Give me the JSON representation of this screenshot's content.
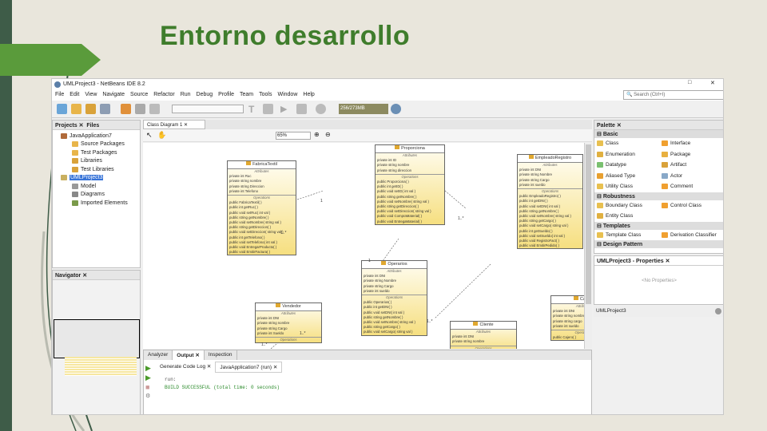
{
  "slide": {
    "title": "Entorno desarrollo"
  },
  "window": {
    "title": "UMLProject3 - NetBeans IDE 8.2",
    "search_placeholder": "Search (Ctrl+I)",
    "memory": "256/273MB"
  },
  "menu": [
    "File",
    "Edit",
    "View",
    "Navigate",
    "Source",
    "Refactor",
    "Run",
    "Debug",
    "Profile",
    "Team",
    "Tools",
    "Window",
    "Help"
  ],
  "projects": {
    "tabs": [
      "Projects",
      "Files"
    ],
    "items": [
      {
        "label": "JavaApplication7",
        "level": 0
      },
      {
        "label": "Source Packages",
        "level": 1
      },
      {
        "label": "Test Packages",
        "level": 1
      },
      {
        "label": "Libraries",
        "level": 1
      },
      {
        "label": "Test Libraries",
        "level": 1
      },
      {
        "label": "UMLProject3",
        "level": 0,
        "selected": true
      },
      {
        "label": "Model",
        "level": 1
      },
      {
        "label": "Diagrams",
        "level": 1
      },
      {
        "label": "Imported Elements",
        "level": 1
      }
    ]
  },
  "navigator": {
    "tab": "Navigator"
  },
  "editor": {
    "tab": "Class Diagram 1",
    "zoom": "65%"
  },
  "classes": [
    {
      "name": "FabricaTextil",
      "attrs": [
        "private int Ruc",
        "private string nombre",
        "private string Direccion",
        "private int Telefono"
      ],
      "ops": [
        "public FabricaTextil( )",
        "public int getRuc( )",
        "public void setRuc( int val )",
        "public string getNombre( )",
        "public void setNombre( string val )",
        "public string getDireccion( )",
        "public void setDireccion( string val )",
        "public int getTelefono( )",
        "public void setTelefono( int val )",
        "public void EntregarProducto( )",
        "public void EmitirFactura( )"
      ]
    },
    {
      "name": "Proporciona",
      "attrs": [
        "private int ID",
        "private string nombre",
        "private string direccion"
      ],
      "ops": [
        "public Proporciona( )",
        "public int getID( )",
        "public void setID( int val )",
        "public string getNombre( )",
        "public void setNombre( string val )",
        "public string getDireccion( )",
        "public void setDireccion( string val )",
        "public void CompraMaterial( )",
        "public void EntregaMaterial( )"
      ]
    },
    {
      "name": "EmpleadoRegistro",
      "attrs": [
        "private int DNI",
        "private string Nombre",
        "private string Cargo",
        "private int sueldo"
      ],
      "ops": [
        "public EmpleadoRegistro( )",
        "public int getDNI( )",
        "public void setDNI( int val )",
        "public string getNombre( )",
        "public void setNombre( string val )",
        "public string getCargo( )",
        "public void setCargo( string val )",
        "public int getSueldo( )",
        "public void setSueldo( int val )",
        "public void RegistroFact( )",
        "public void EmitirPedido( )"
      ]
    },
    {
      "name": "Operarios",
      "attrs": [
        "private int DNI",
        "private string Nombre",
        "private string Cargo",
        "private int sueldo"
      ],
      "ops": [
        "public Operarios( )",
        "public int getDNI( )",
        "public void setDNI( int val )",
        "public string getNombre( )",
        "public void setNombre( string val )",
        "public string getCargo( )",
        "public void setCargo( string val )"
      ]
    },
    {
      "name": "Vendedor",
      "attrs": [
        "private int DNI",
        "private string nombre",
        "private string Cargo",
        "private int Sueldo"
      ],
      "ops": []
    },
    {
      "name": "Cliente",
      "attrs": [
        "private int DNI",
        "private string nombre"
      ],
      "ops": []
    },
    {
      "name": "Cajero",
      "attrs": [
        "private int DNI",
        "private string nombre",
        "private string cargo",
        "private int sueldo"
      ],
      "ops": [
        "public Cajero( )"
      ]
    }
  ],
  "section_labels": {
    "attributes": "Attributes",
    "operations": "Operations"
  },
  "multiplicities": [
    "1..*",
    "1",
    "1..*",
    "1",
    "1..*",
    "1..*",
    "1..*",
    "1"
  ],
  "output": {
    "tabs": [
      "Analyzer",
      "Output",
      "Inspection"
    ],
    "subtabs": [
      "Generate Code Log",
      "JavaApplication7 (run)"
    ],
    "lines": [
      "run:",
      "BUILD SUCCESSFUL (total time: 0 seconds)"
    ]
  },
  "palette": {
    "tab": "Palette",
    "groups": [
      {
        "name": "Basic",
        "items": [
          "Class",
          "Interface",
          "Enumeration",
          "Package",
          "Datatype",
          "Artifact",
          "Aliased Type",
          "Actor",
          "Utility Class",
          "Comment"
        ]
      },
      {
        "name": "Robustness",
        "items": [
          "Boundary Class",
          "Control Class",
          "Entity Class"
        ]
      },
      {
        "name": "Templates",
        "items": [
          "Template Class",
          "Derivation Classifier"
        ]
      },
      {
        "name": "Design Pattern",
        "items": []
      }
    ]
  },
  "properties": {
    "tab": "UMLProject3 - Properties",
    "empty": "<No Properties>",
    "footer": "UMLProject3"
  }
}
